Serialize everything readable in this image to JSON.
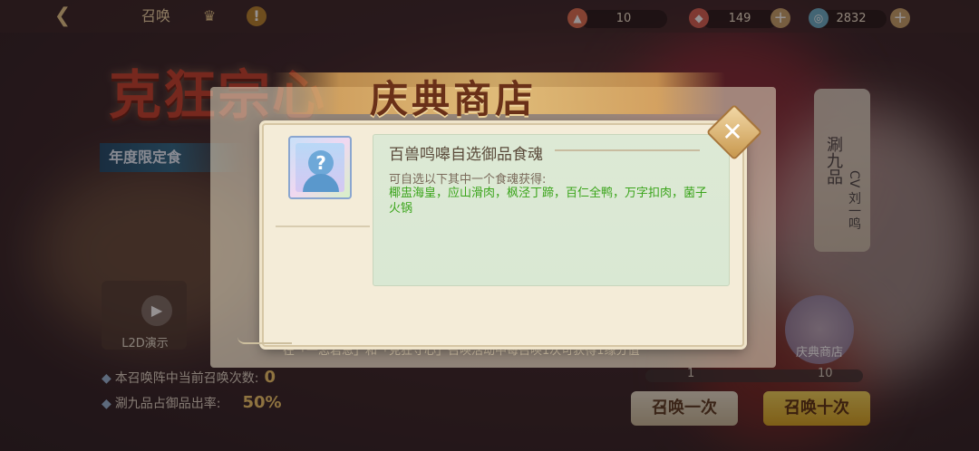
{
  "topbar": {
    "back_icon": "back-arrow-icon",
    "title": "召唤",
    "resources": [
      {
        "icon": "ticket-icon",
        "value": "10"
      },
      {
        "icon": "fish-ticket-icon",
        "value": "149"
      },
      {
        "icon": "gem-icon",
        "value": "2832"
      }
    ]
  },
  "background": {
    "event_title": "克狂宗心",
    "event_subtitle": "年度限定食",
    "vertical_banner": {
      "grade": "涮九品",
      "cv": "CV 刘一鸣"
    },
    "celebrate_shop": "庆典商店",
    "l2d_label": "L2D演示",
    "summon_count_label": "本召唤阵中当前召唤次数:",
    "summon_count_value": "0",
    "rate_label": "涮九品占御品出率:",
    "rate_value": "50%",
    "note": "在「一恋君恩」和「克狂守心」召唤活动中每召唤1次可获得1缘分值",
    "progress_min": "1",
    "progress_max": "10",
    "btn_once": "召唤一次",
    "btn_ten": "召唤十次"
  },
  "shop": {
    "title": "庆典商店"
  },
  "dialog": {
    "item_icon": "question-soul-icon",
    "item_name": "百兽鸣嗥自选御品食魂",
    "desc_intro": "可自选以下其中一个食魂获得:",
    "desc_items": "椰盅海皇，应山滑肉，枫泾丁蹄，百仁全鸭，万字扣肉，菌子火锅",
    "close_icon": "close-icon"
  },
  "colors": {
    "dialog_bg": "#f4ecd8",
    "desc_box": "#dde9d5",
    "highlight_green": "#3aa41a",
    "accent_gold": "#c8984e"
  }
}
